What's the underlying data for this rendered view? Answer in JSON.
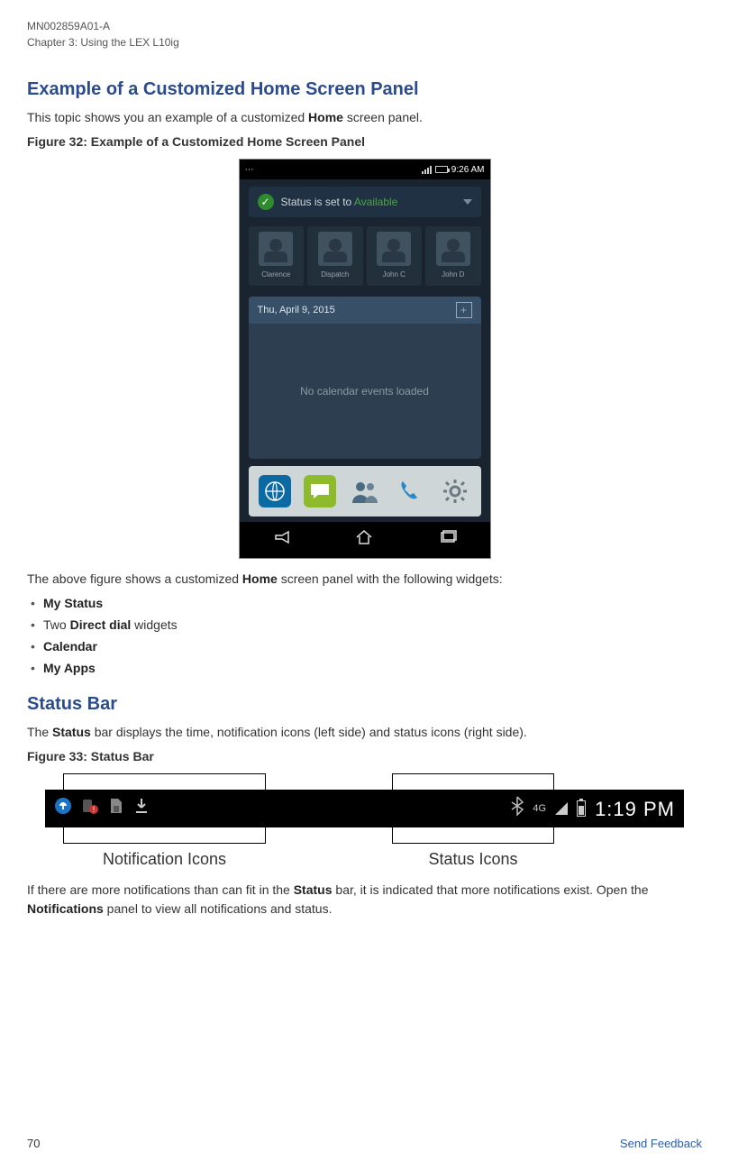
{
  "doc_id": "MN002859A01-A",
  "chapter_line": "Chapter 3:  Using the LEX L10ig",
  "s1": {
    "heading": "Example of a Customized Home Screen Panel",
    "intro_pre": "This topic shows you an example of a customized ",
    "intro_b": "Home",
    "intro_post": " screen panel.",
    "fig_caption": "Figure 32: Example of a Customized Home Screen Panel",
    "phone": {
      "time": "9:26 AM",
      "status_pre": "Status is set to ",
      "status_val": "Available",
      "contacts": [
        "Clarence",
        "Dispatch",
        "John C",
        "John D"
      ],
      "cal_date": "Thu, April 9, 2015",
      "cal_body": "No calendar events loaded"
    },
    "after_fig_pre": "The above figure shows a customized ",
    "after_fig_b": "Home",
    "after_fig_post": " screen panel with the following widgets:",
    "bullets": {
      "b1": "My Status",
      "b2_pre": "Two ",
      "b2_b": "Direct dial",
      "b2_post": " widgets",
      "b3": "Calendar",
      "b4": "My Apps"
    }
  },
  "s2": {
    "heading": "Status Bar",
    "intro_pre": "The ",
    "intro_b": "Status",
    "intro_post": " bar displays the time, notification icons (left side) and status icons (right side).",
    "fig_caption": "Figure 33: Status Bar",
    "fg_label": "4G",
    "time": "1:19 PM",
    "label_notif": "Notification Icons",
    "label_status": "Status Icons",
    "p_pre": "If there are more notifications than can fit in the ",
    "p_b1": "Status",
    "p_mid": " bar, it is indicated that more notifications exist. Open the ",
    "p_b2": "Notifications",
    "p_post": " panel to view all notifications and status."
  },
  "footer": {
    "page": "70",
    "link": "Send Feedback"
  }
}
